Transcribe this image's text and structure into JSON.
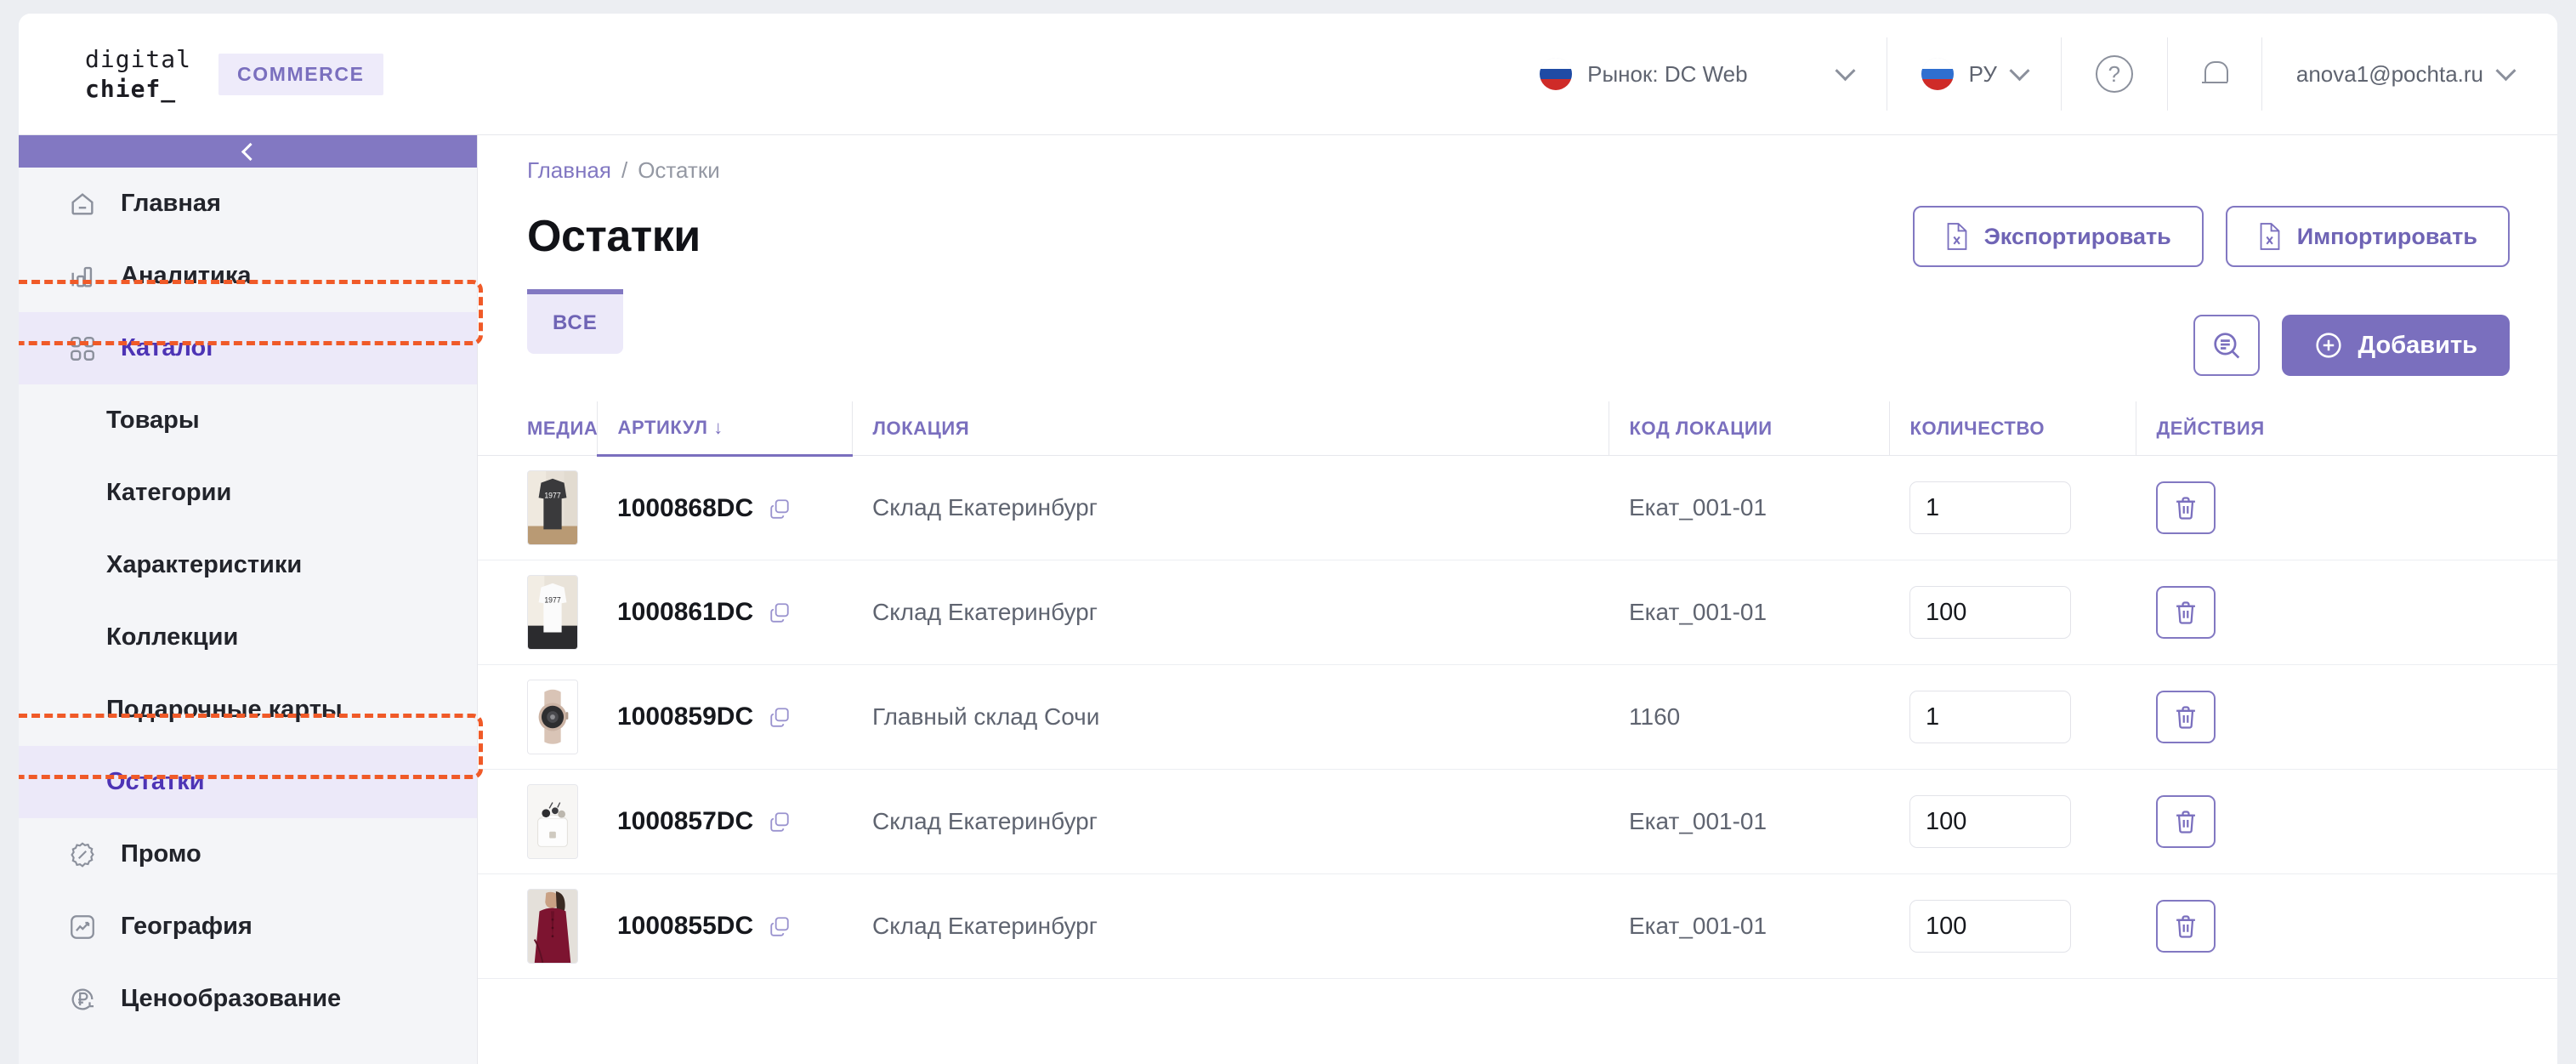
{
  "brand": {
    "logo_line1": "digital",
    "logo_line2": "chief_",
    "badge": "COMMERCE"
  },
  "header": {
    "market_label": "Рынок: DC Web",
    "language": "РУ",
    "help_icon": "question-mark-icon",
    "notifications_icon": "bell-icon",
    "account": "anova1@pochta.ru"
  },
  "sidebar": {
    "collapse_icon": "chevron-left-icon",
    "items": [
      {
        "label": "Главная",
        "icon": "home-icon",
        "type": "top",
        "active": false
      },
      {
        "label": "Аналитика",
        "icon": "bar-chart-icon",
        "type": "top",
        "active": false
      },
      {
        "label": "Каталог",
        "icon": "grid-icon",
        "type": "top",
        "active": true,
        "highlighted": true
      },
      {
        "label": "Товары",
        "icon": "",
        "type": "sub",
        "active": false
      },
      {
        "label": "Категории",
        "icon": "",
        "type": "sub",
        "active": false
      },
      {
        "label": "Характеристики",
        "icon": "",
        "type": "sub",
        "active": false
      },
      {
        "label": "Коллекции",
        "icon": "",
        "type": "sub",
        "active": false
      },
      {
        "label": "Подарочные карты",
        "icon": "",
        "type": "sub",
        "active": false
      },
      {
        "label": "Остатки",
        "icon": "",
        "type": "sub",
        "active": true,
        "highlighted": true
      },
      {
        "label": "Промо",
        "icon": "percent-badge-icon",
        "type": "top",
        "active": false
      },
      {
        "label": "География",
        "icon": "trend-box-icon",
        "type": "top",
        "active": false
      },
      {
        "label": "Ценообразование",
        "icon": "ruble-refresh-icon",
        "type": "top",
        "active": false
      }
    ]
  },
  "breadcrumb": {
    "home": "Главная",
    "separator": "/",
    "current": "Остатки"
  },
  "page": {
    "title": "Остатки",
    "export_label": "Экспортировать",
    "import_label": "Импортировать",
    "export_icon": "xls-file-icon",
    "import_icon": "xls-file-icon",
    "tab_all": "ВСЕ",
    "search_icon": "filter-search-icon",
    "add_label": "Добавить",
    "add_icon": "plus-circle-icon"
  },
  "table": {
    "columns": [
      {
        "key": "media",
        "label": "МЕДИА",
        "sorted": false
      },
      {
        "key": "sku",
        "label": "АРТИКУЛ",
        "sorted": true,
        "sort_icon": "arrow-down-icon"
      },
      {
        "key": "location",
        "label": "ЛОКАЦИЯ",
        "sorted": false
      },
      {
        "key": "location_code",
        "label": "КОД ЛОКАЦИИ",
        "sorted": false
      },
      {
        "key": "quantity",
        "label": "КОЛИЧЕСТВО",
        "sorted": false
      },
      {
        "key": "actions",
        "label": "ДЕЙСТВИЯ",
        "sorted": false
      }
    ],
    "sort_arrow": "↓",
    "copy_icon": "copy-icon",
    "delete_icon": "trash-icon",
    "rows": [
      {
        "thumb": "dark-tshirt-1977",
        "sku": "1000868DC",
        "location": "Склад Екатеринбург",
        "location_code": "Екат_001-01",
        "quantity": "1"
      },
      {
        "thumb": "white-tshirt-1977",
        "sku": "1000861DC",
        "location": "Склад Екатеринбург",
        "location_code": "Екат_001-01",
        "quantity": "100"
      },
      {
        "thumb": "beige-smartwatch",
        "sku": "1000859DC",
        "location": "Главный склад Сочи",
        "location_code": "1160",
        "quantity": "1"
      },
      {
        "thumb": "white-bag-accessories",
        "sku": "1000857DC",
        "location": "Склад Екатеринбург",
        "location_code": "Екат_001-01",
        "quantity": "100"
      },
      {
        "thumb": "burgundy-blouse",
        "sku": "1000855DC",
        "location": "Склад Екатеринбург",
        "location_code": "Екат_001-01",
        "quantity": "100"
      }
    ]
  },
  "colors": {
    "accent": "#7a6fbe",
    "accent_dark": "#4d34b5",
    "accent_soft": "#ece9f9",
    "highlight": "#f05a28",
    "sidebar_bg": "#f4f5f8",
    "text": "#16181d",
    "muted": "#5f6470"
  }
}
